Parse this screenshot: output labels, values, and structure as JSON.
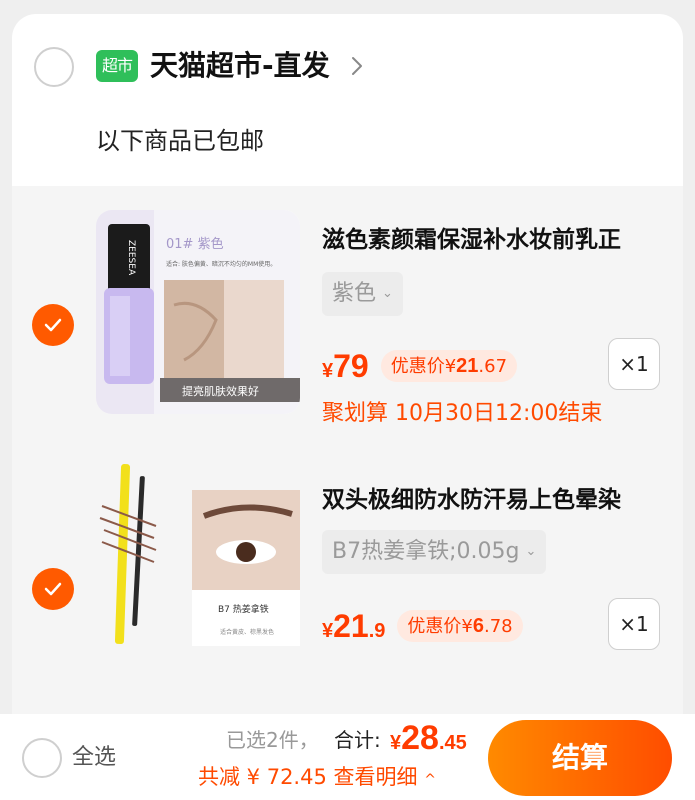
{
  "store": {
    "logo_text": "超市",
    "name": "天猫超市-直发",
    "shipping_note": "以下商品已包邮"
  },
  "items": [
    {
      "checked": true,
      "thumb": {
        "brand": "ZEESEA",
        "shade_label": "01# 紫色",
        "suit_text": "适合: 肤色偏黄、暗沉不均匀的MM使用。",
        "caption": "提亮肌肤效果好"
      },
      "title": "滋色素颜霜保湿补水妆前乳正",
      "variant": "紫色",
      "price": {
        "currency": "¥",
        "int": "79",
        "dec": ""
      },
      "promo": {
        "label": "优惠价",
        "currency": "¥",
        "int": "21",
        "dec": ".67"
      },
      "quantity": "×1",
      "deal_text": "聚划算 10月30日12:00结束"
    },
    {
      "checked": true,
      "thumb": {
        "shade_label": "B7 热姜拿铁",
        "note": "适合黄皮、棕黑发色"
      },
      "title": "双头极细防水防汗易上色晕染",
      "variant": "B7热姜拿铁;0.05g",
      "price": {
        "currency": "¥",
        "int": "21",
        "dec": ".9"
      },
      "promo": {
        "label": "优惠价",
        "currency": "¥",
        "int": "6",
        "dec": ".78"
      },
      "quantity": "×1"
    }
  ],
  "footer": {
    "select_all": "全选",
    "selected_count": "已选2件，",
    "total_label": "合计:",
    "total": {
      "currency": "¥",
      "int": "28",
      "dec": ".45"
    },
    "discount_text": "共减 ¥ 72.45 查看明细",
    "checkout_label": "结算"
  },
  "colors": {
    "accent": "#ff5a00",
    "price": "#ff3c00",
    "store_logo": "#2fbf5a"
  },
  "icons": [
    "chevron-right-icon",
    "checkmark-icon",
    "caret-down-icon",
    "caret-up-icon"
  ]
}
